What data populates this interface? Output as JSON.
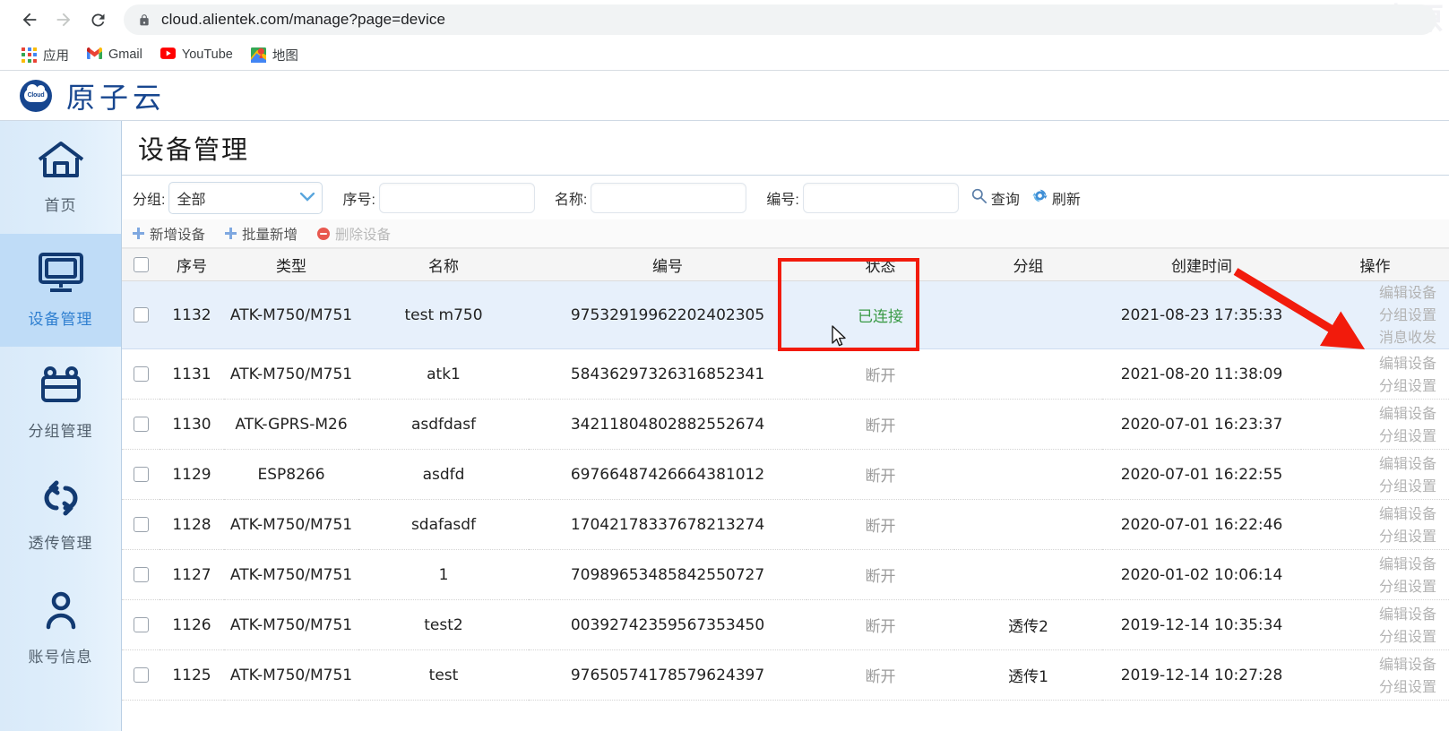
{
  "browser": {
    "back_icon": "back-arrow-icon",
    "forward_icon": "forward-arrow-icon",
    "reload_icon": "reload-icon",
    "lock_icon": "lock-icon",
    "url_host": "cloud.alientek.com",
    "url_path": "/manage?page=device",
    "url_full": "cloud.alientek.com/manage?page=device",
    "watermark": "正点原",
    "bookmarks": [
      {
        "label": "应用",
        "icon": "apps-grid-icon"
      },
      {
        "label": "Gmail",
        "icon": "gmail-icon"
      },
      {
        "label": "YouTube",
        "icon": "youtube-icon"
      },
      {
        "label": "地图",
        "icon": "maps-icon"
      }
    ]
  },
  "header": {
    "logo_text": "Cloud",
    "logo_icon": "cloud-logo-icon",
    "brand": "原子云"
  },
  "sidebar": {
    "items": [
      {
        "label": "首页",
        "icon": "home-icon",
        "active": false
      },
      {
        "label": "设备管理",
        "icon": "monitor-icon",
        "active": true
      },
      {
        "label": "分组管理",
        "icon": "group-icon",
        "active": false
      },
      {
        "label": "透传管理",
        "icon": "transfer-icon",
        "active": false
      },
      {
        "label": "账号信息",
        "icon": "user-icon",
        "active": false
      }
    ]
  },
  "main": {
    "title": "设备管理",
    "filters": {
      "group_label": "分组:",
      "group_value": "全部",
      "group_options": [
        "全部"
      ],
      "serial_label": "序号:",
      "serial_value": "",
      "name_label": "名称:",
      "name_value": "",
      "number_label": "编号:",
      "number_value": "",
      "search_button": "查询",
      "search_icon": "search-icon",
      "refresh_button": "刷新",
      "refresh_icon": "refresh-icon"
    },
    "actions": [
      {
        "label": "新增设备",
        "icon": "plus-icon",
        "disabled": false
      },
      {
        "label": "批量新增",
        "icon": "plus-icon",
        "disabled": false
      },
      {
        "label": "删除设备",
        "icon": "minus-circle-icon",
        "disabled": true
      }
    ],
    "table": {
      "columns": [
        "",
        "序号",
        "类型",
        "名称",
        "编号",
        "状态",
        "分组",
        "创建时间",
        "操作"
      ],
      "rows": [
        {
          "id": "1132",
          "type": "ATK-M750/M751",
          "name": "test m750",
          "number": "97532919962202402305",
          "status": "已连接",
          "status_state": "connected",
          "group": "",
          "created": "2021-08-23 17:35:33",
          "ops": [
            "编辑设备",
            "分组设置",
            "消息收发"
          ],
          "highlight": true
        },
        {
          "id": "1131",
          "type": "ATK-M750/M751",
          "name": "atk1",
          "number": "58436297326316852341",
          "status": "断开",
          "status_state": "disconnected",
          "group": "",
          "created": "2021-08-20 11:38:09",
          "ops": [
            "编辑设备",
            "分组设置"
          ],
          "highlight": false
        },
        {
          "id": "1130",
          "type": "ATK-GPRS-M26",
          "name": "asdfdasf",
          "number": "34211804802882552674",
          "status": "断开",
          "status_state": "disconnected",
          "group": "",
          "created": "2020-07-01 16:23:37",
          "ops": [
            "编辑设备",
            "分组设置"
          ],
          "highlight": false
        },
        {
          "id": "1129",
          "type": "ESP8266",
          "name": "asdfd",
          "number": "69766487426664381012",
          "status": "断开",
          "status_state": "disconnected",
          "group": "",
          "created": "2020-07-01 16:22:55",
          "ops": [
            "编辑设备",
            "分组设置"
          ],
          "highlight": false
        },
        {
          "id": "1128",
          "type": "ATK-M750/M751",
          "name": "sdafasdf",
          "number": "17042178337678213274",
          "status": "断开",
          "status_state": "disconnected",
          "group": "",
          "created": "2020-07-01 16:22:46",
          "ops": [
            "编辑设备",
            "分组设置"
          ],
          "highlight": false
        },
        {
          "id": "1127",
          "type": "ATK-M750/M751",
          "name": "1",
          "number": "70989653485842550727",
          "status": "断开",
          "status_state": "disconnected",
          "group": "",
          "created": "2020-01-02 10:06:14",
          "ops": [
            "编辑设备",
            "分组设置"
          ],
          "highlight": false
        },
        {
          "id": "1126",
          "type": "ATK-M750/M751",
          "name": "test2",
          "number": "00392742359567353450",
          "status": "断开",
          "status_state": "disconnected",
          "group": "透传2",
          "created": "2019-12-14 10:35:34",
          "ops": [
            "编辑设备",
            "分组设置"
          ],
          "highlight": false
        },
        {
          "id": "1125",
          "type": "ATK-M750/M751",
          "name": "test",
          "number": "97650574178579624397",
          "status": "断开",
          "status_state": "disconnected",
          "group": "透传1",
          "created": "2019-12-14 10:27:28",
          "ops": [
            "编辑设备",
            "分组设置"
          ],
          "highlight": false
        }
      ]
    }
  },
  "annotations": {
    "highlight_box_color": "#f21b0c",
    "arrow_color": "#f21b0c",
    "highlight_target": "状态",
    "arrow_target": "消息收发"
  },
  "colors": {
    "brand_blue": "#17468f",
    "sidebar_active": "#bfdcf7",
    "status_connected": "#3a9a46",
    "status_disconnected": "#9b9b9b",
    "annotation_red": "#f21b0c"
  }
}
